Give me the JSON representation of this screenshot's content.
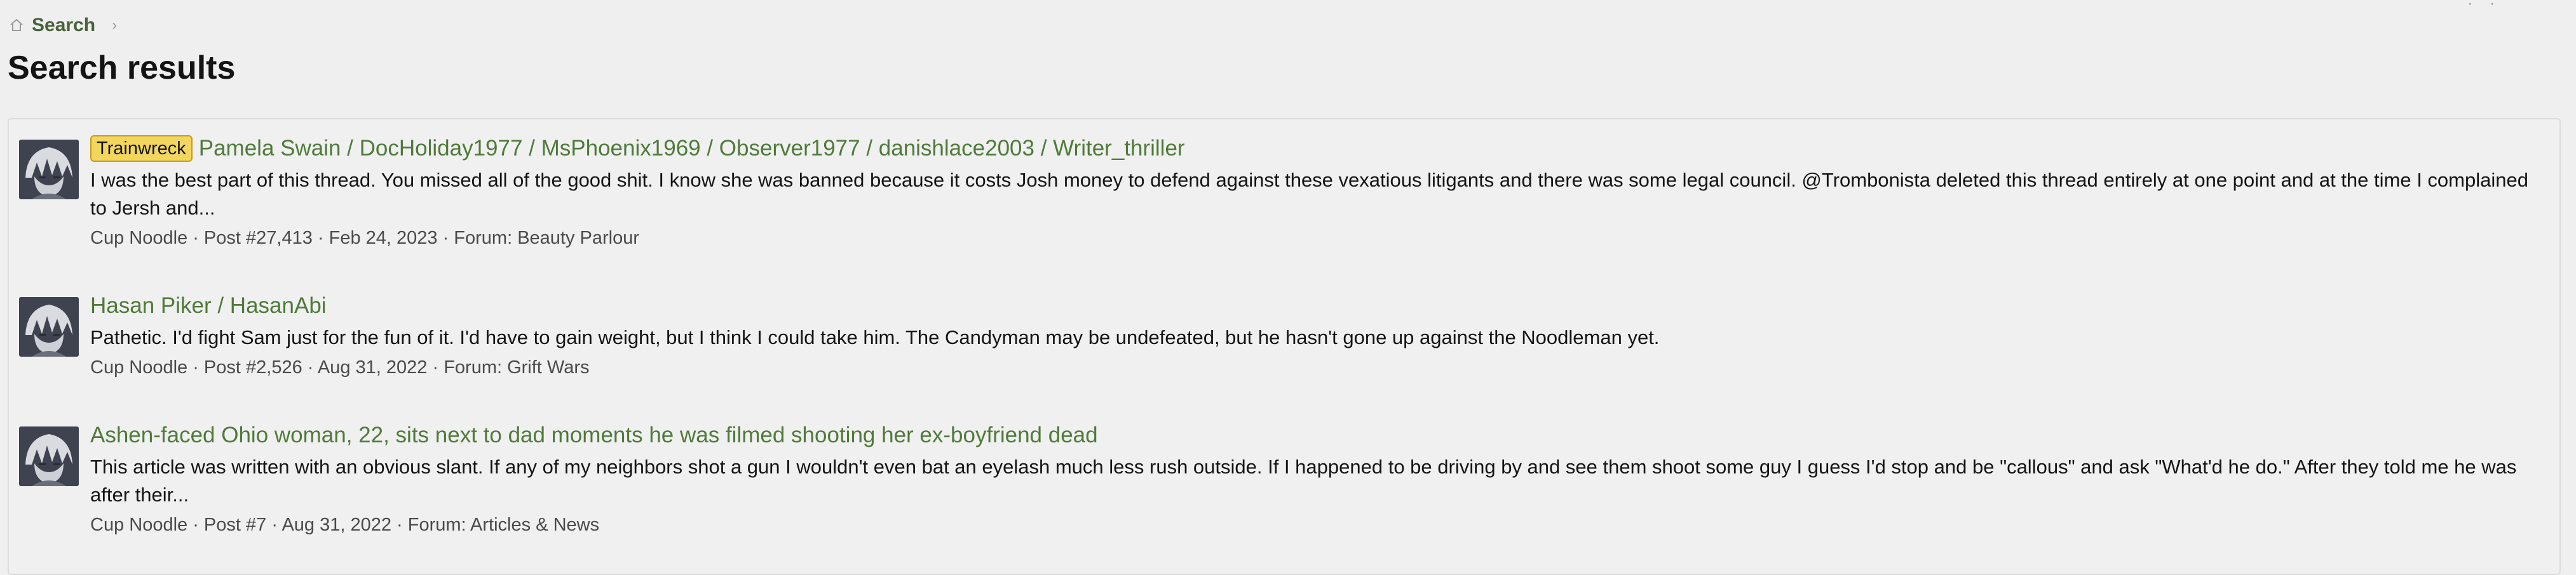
{
  "breadcrumb": {
    "home_icon": "home-icon",
    "label": "Search",
    "separator": "›"
  },
  "top_corner_glyphs": "· ·",
  "page": {
    "title": "Search results"
  },
  "results": [
    {
      "prefix": "Trainwreck",
      "title": "Pamela Swain / DocHoliday1977 / MsPhoenix1969 / Observer1977 / danishlace2003 / Writer_thriller",
      "snippet": "I was the best part of this thread. You missed all of the good shit. I know she was banned because it costs Josh money to defend against these vexatious litigants and there was some legal council. @Trombonista deleted this thread entirely at one point and at the time I complained to Jersh and...",
      "meta": "Cup Noodle · Post #27,413 · Feb 24, 2023 · Forum: Beauty Parlour"
    },
    {
      "prefix": "",
      "title": "Hasan Piker / HasanAbi",
      "snippet": "Pathetic. I'd fight Sam just for the fun of it. I'd have to gain weight, but I think I could take him. The Candyman may be undefeated, but he hasn't gone up against the Noodleman yet.",
      "meta": "Cup Noodle · Post #2,526 · Aug 31, 2022 · Forum: Grift Wars"
    },
    {
      "prefix": "",
      "title": "Ashen-faced Ohio woman, 22, sits next to dad moments he was filmed shooting her ex-boyfriend dead",
      "snippet": "This article was written with an obvious slant. If any of my neighbors shot a gun I wouldn't even bat an eyelash much less rush outside. If I happened to be driving by and see them shoot some guy I guess I'd stop and be \"callous\" and ask \"What'd he do.\" After they told me he was after their...",
      "meta": "Cup Noodle · Post #7 · Aug 31, 2022 · Forum: Articles & News"
    }
  ],
  "colors": {
    "link": "#4f7a3a",
    "breadcrumb": "#47623a",
    "badge_bg": "#f3d65e",
    "badge_border": "#c79b1c",
    "page_bg": "#efefef"
  }
}
